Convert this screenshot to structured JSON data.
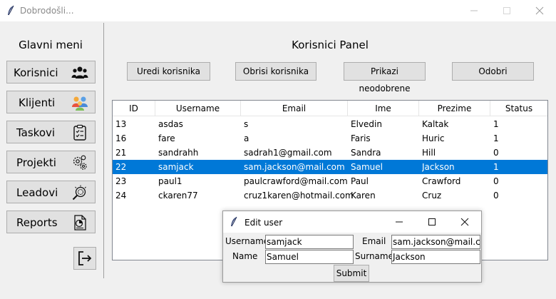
{
  "window": {
    "title": "Dobrodošli..."
  },
  "sidebar": {
    "title": "Glavni meni",
    "items": [
      {
        "label": "Korisnici",
        "icon": "users-icon"
      },
      {
        "label": "Klijenti",
        "icon": "clients-icon"
      },
      {
        "label": "Taskovi",
        "icon": "clipboard-icon"
      },
      {
        "label": "Projekti",
        "icon": "gears-icon"
      },
      {
        "label": "Leadovi",
        "icon": "search-gear-icon"
      },
      {
        "label": "Reports",
        "icon": "report-chart-icon"
      }
    ],
    "exit_icon": "logout-icon"
  },
  "main": {
    "title": "Korisnici Panel",
    "actions": {
      "edit": "Uredi korisnika",
      "delete": "Obrisi korisnika",
      "unapproved": "Prikazi neodobrene",
      "approve": "Odobri"
    }
  },
  "table": {
    "columns": [
      "ID",
      "Username",
      "Email",
      "Ime",
      "Prezime",
      "Status"
    ],
    "rows": [
      [
        "13",
        "asdas",
        "s",
        "Elvedin",
        "Kaltak",
        "1"
      ],
      [
        "16",
        "fare",
        "a",
        "Faris",
        "Huric",
        "1"
      ],
      [
        "21",
        "sandrahh",
        "sadrah1@gmail.com",
        "Sandra",
        "Hill",
        "0"
      ],
      [
        "22",
        "samjack",
        "sam.jackson@mail.com",
        "Samuel",
        "Jackson",
        "1"
      ],
      [
        "23",
        "paul1",
        "paulcrawford@mail.com",
        "Paul",
        "Crawford",
        "0"
      ],
      [
        "24",
        "ckaren77",
        "cruz1karen@hotmail.com",
        "Karen",
        "Cruz",
        "0"
      ]
    ],
    "selected_index": 3
  },
  "dialog": {
    "title": "Edit user",
    "username_label": "Username",
    "username_value": "samjack",
    "email_label": "Email",
    "email_value": "sam.jackson@mail.com",
    "name_label": "Name",
    "name_value": "Samuel",
    "surname_label": "Surname",
    "surname_value": "Jackson",
    "submit_label": "Submit"
  },
  "colors": {
    "selection": "#0078d7",
    "background": "#f0f0f0",
    "button": "#e1e1e1"
  }
}
